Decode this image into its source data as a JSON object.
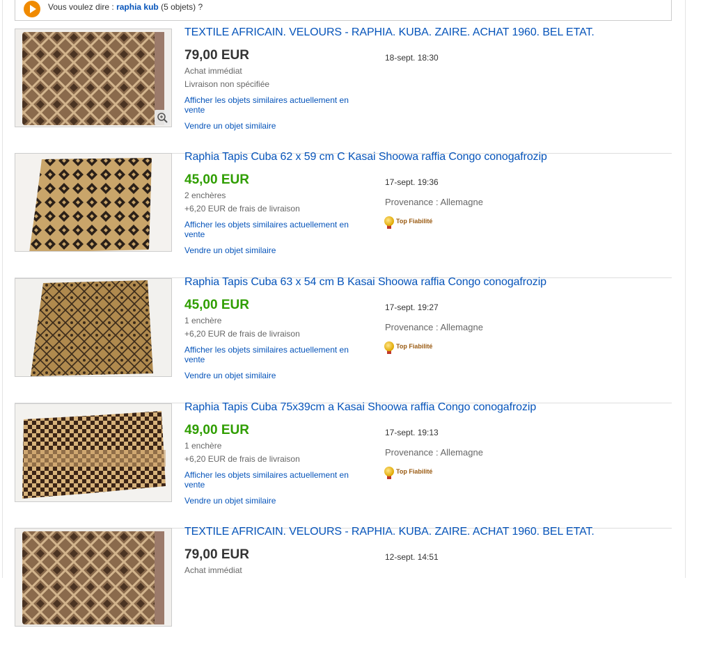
{
  "suggestion": {
    "prefix": "Vous voulez dire : ",
    "term": "raphia kub",
    "suffix": " (5 objets) ?"
  },
  "labels": {
    "similar": "Afficher les objets similaires actuellement en vente",
    "sell": "Vendre un objet similaire"
  },
  "colors": {
    "link": "#0654ba",
    "price_green": "#2f9e00",
    "accent_orange": "#f08a00"
  },
  "items": [
    {
      "title": "TEXTILE AFRICAIN. VELOURS - RAPHIA. KUBA. ZAIRE. ACHAT 1960. BEL ETAT.",
      "price": "79,00 EUR",
      "line1": "Achat immédiat",
      "line2": "Livraison non spécifiée",
      "date": "18-sept. 18:30"
    },
    {
      "title": "Raphia Tapis Cuba 62 x 59 cm C Kasai Shoowa raffia Congo conogafrozip",
      "price": "45,00 EUR",
      "line1": "2 enchères",
      "line2": "+6,20 EUR de frais de livraison",
      "date": "17-sept. 19:36",
      "origin": "Provenance : Allemagne",
      "badge": "Top Fiabilité"
    },
    {
      "title": "Raphia Tapis Cuba 63 x 54 cm B Kasai Shoowa raffia Congo conogafrozip",
      "price": "45,00 EUR",
      "line1": "1 enchère",
      "line2": "+6,20 EUR de frais de livraison",
      "date": "17-sept. 19:27",
      "origin": "Provenance : Allemagne",
      "badge": "Top Fiabilité"
    },
    {
      "title": "Raphia Tapis Cuba 75x39cm a Kasai Shoowa raffia Congo conogafrozip",
      "price": "49,00 EUR",
      "line1": "1 enchère",
      "line2": "+6,20 EUR de frais de livraison",
      "date": "17-sept. 19:13",
      "origin": "Provenance : Allemagne",
      "badge": "Top Fiabilité"
    },
    {
      "title": "TEXTILE AFRICAIN. VELOURS - RAPHIA. KUBA. ZAIRE. ACHAT 1960. BEL ETAT.",
      "price": "79,00 EUR",
      "line1": "Achat immédiat",
      "date": "12-sept. 14:51"
    }
  ]
}
